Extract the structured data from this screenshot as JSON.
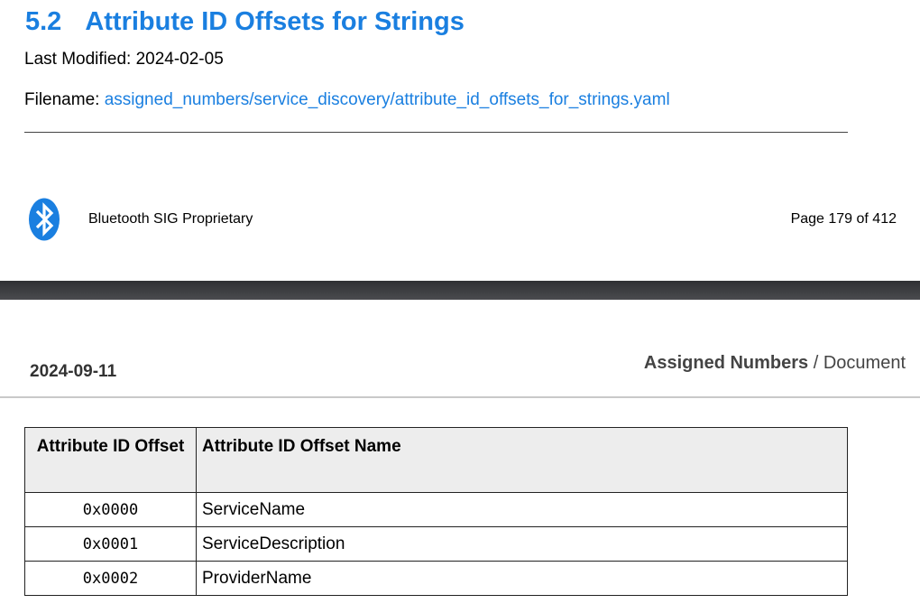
{
  "section": {
    "number": "5.2",
    "title": "Attribute ID Offsets for Strings",
    "last_modified_label": "Last Modified:",
    "last_modified_value": "2024-02-05",
    "filename_label": "Filename:",
    "filename_value": "assigned_numbers/service_discovery/attribute_id_offsets_for_strings.yaml"
  },
  "footer": {
    "logo_icon": "bluetooth-icon",
    "proprietary": "Bluetooth SIG Proprietary",
    "page": "Page 179 of 412"
  },
  "header": {
    "date": "2024-09-11",
    "doc_bold": "Assigned Numbers",
    "doc_rest": " / Document"
  },
  "table": {
    "headers": [
      "Attribute ID Offset",
      "Attribute ID Offset Name"
    ],
    "rows": [
      [
        "0x0000",
        "ServiceName"
      ],
      [
        "0x0001",
        "ServiceDescription"
      ],
      [
        "0x0002",
        "ProviderName"
      ]
    ]
  },
  "colors": {
    "heading": "#1a7fe0",
    "link": "#1a7fe0",
    "bluetooth_blue": "#1a7fe0",
    "page_separator": "#3a3b3e"
  }
}
